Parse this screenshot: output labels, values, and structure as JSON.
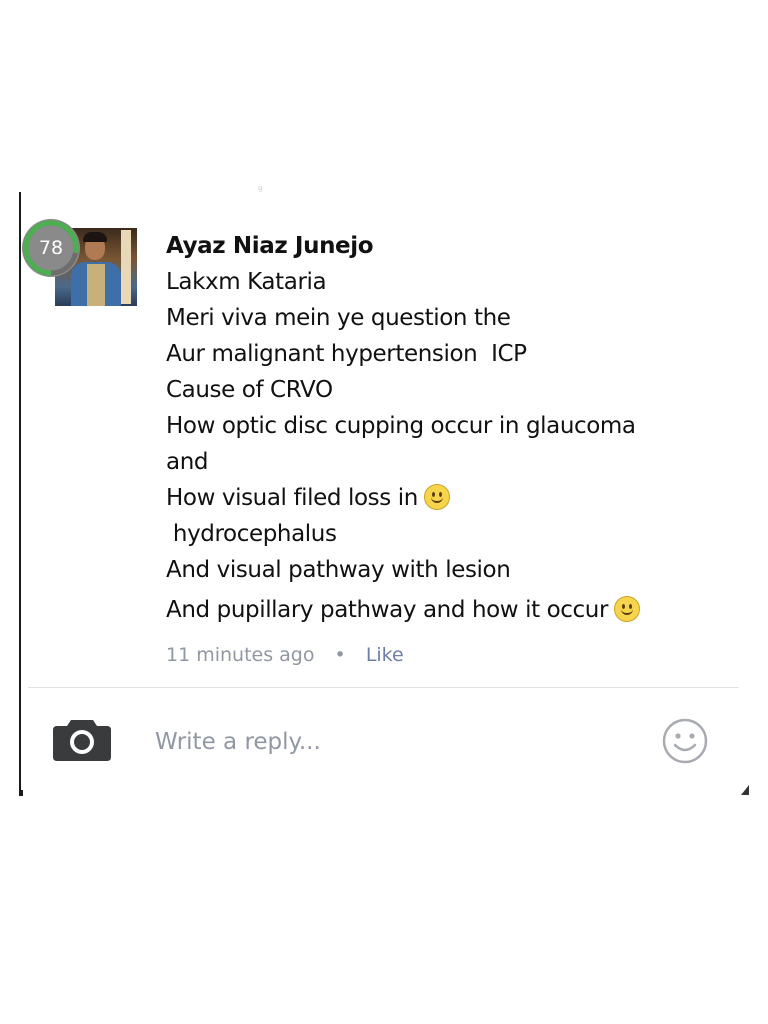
{
  "comment": {
    "score_badge": "78",
    "author": "Ayaz Niaz Junejo",
    "lines": [
      "Lakxm Kataria",
      "Meri viva mein ye question the",
      "Aur malignant hypertension  ICP",
      "Cause of CRVO",
      "How optic disc cupping occur in glaucoma",
      "and",
      "How visual filed loss in",
      " hydrocephalus",
      "And visual pathway with lesion",
      "And pupillary pathway and how it occur"
    ],
    "timestamp": "11 minutes ago",
    "separator": "•",
    "like_label": "Like"
  },
  "reply": {
    "placeholder": "Write a reply..."
  },
  "icons": {
    "camera": "camera-icon",
    "emoji": "smiley-face-icon",
    "inline_emoji": "slightly-smiling-face-emoji"
  },
  "colors": {
    "meta_text": "#9197a3",
    "like_link": "#6d7fa8",
    "badge_ring": "#4caf50",
    "badge_bg": "#8a8a8a"
  }
}
